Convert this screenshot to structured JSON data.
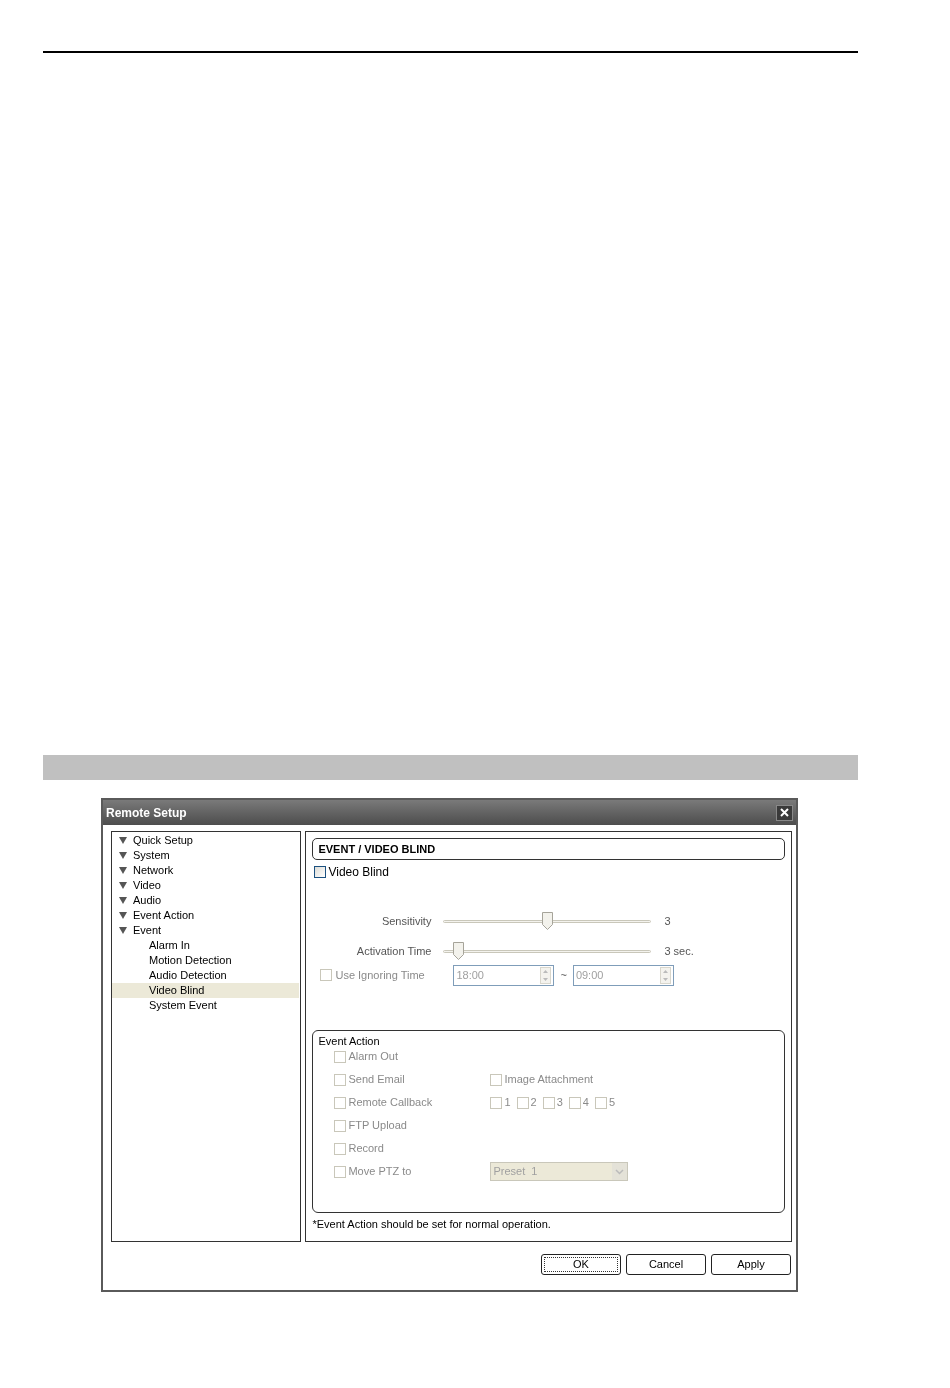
{
  "window": {
    "title": "Remote Setup"
  },
  "tree": [
    {
      "label": "Quick Setup",
      "selected": false
    },
    {
      "label": "System",
      "selected": false
    },
    {
      "label": "Network",
      "selected": false
    },
    {
      "label": "Video",
      "selected": false
    },
    {
      "label": "Audio",
      "selected": false
    },
    {
      "label": "Event Action",
      "selected": false
    },
    {
      "label": "Event",
      "selected": false,
      "children": [
        {
          "label": "Alarm In",
          "selected": false
        },
        {
          "label": "Motion Detection",
          "selected": false
        },
        {
          "label": "Audio Detection",
          "selected": false
        },
        {
          "label": "Video Blind",
          "selected": true
        },
        {
          "label": "System Event",
          "selected": false
        }
      ]
    }
  ],
  "section_title": "EVENT / VIDEO BLIND",
  "enable": {
    "label": "Video Blind",
    "checked": false,
    "disabled": false
  },
  "sliders": [
    {
      "label": "Sensitivity",
      "level": 0.5,
      "reading": "3"
    },
    {
      "label": "Activation Time",
      "level": 0.07,
      "reading": "3 sec."
    }
  ],
  "ignoring_time": {
    "label": "Use Ignoring Time",
    "checked": false,
    "disabled": true,
    "from": "18:00",
    "separator": "~",
    "to": "09:00"
  },
  "event_action": {
    "title": "Event Action",
    "rows": [
      {
        "kind": "plain",
        "label": "Alarm Out",
        "checked": false,
        "disabled": true
      },
      {
        "kind": "attachment",
        "label": "Send Email",
        "checked": false,
        "disabled": true,
        "option": {
          "label": "Image Attachment",
          "checked": false,
          "disabled": true
        }
      },
      {
        "kind": "numbers",
        "label": "Remote Callback",
        "checked": false,
        "disabled": true,
        "options": [
          {
            "label": "1",
            "checked": false,
            "disabled": true
          },
          {
            "label": "2",
            "checked": false,
            "disabled": true
          },
          {
            "label": "3",
            "checked": false,
            "disabled": true
          },
          {
            "label": "4",
            "checked": false,
            "disabled": true
          },
          {
            "label": "5",
            "checked": false,
            "disabled": true
          }
        ]
      },
      {
        "kind": "plain",
        "label": "FTP Upload",
        "checked": false,
        "disabled": true
      },
      {
        "kind": "plain",
        "label": "Record",
        "checked": false,
        "disabled": true
      },
      {
        "kind": "select",
        "label": "Move PTZ to",
        "checked": false,
        "disabled": true,
        "select": {
          "value": "Preset  1",
          "disabled": true
        }
      }
    ]
  },
  "note": "*Event Action should be set for normal operation.",
  "buttons": [
    {
      "label": "OK",
      "focused": true
    },
    {
      "label": "Cancel",
      "focused": false
    },
    {
      "label": "Apply",
      "focused": false
    }
  ]
}
